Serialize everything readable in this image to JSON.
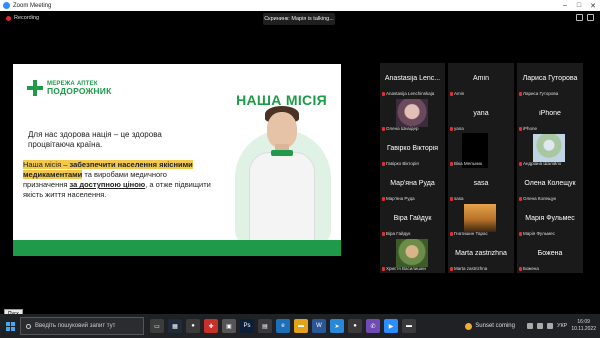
{
  "window": {
    "title": "Zoom Meeting",
    "recording_label": "Recording",
    "talking_indicator": "Скрининк: Марiя is talking..."
  },
  "slide": {
    "logo_line1": "МЕРЕЖА АПТЕК",
    "logo_line2": "ПОДОРОЖНИК",
    "heading": "НАША МІСІЯ",
    "para1": "Для нас здорова нація – це здорова процвітаюча країна.",
    "para2_a": "Наша місія – ",
    "para2_b": "забезпечити населення якісними медикаментами",
    "para2_c": " та виробами медичного призначення ",
    "para2_d": "за доступною ціною",
    "para2_e": ", а отже підвищити якість життя населення.",
    "brand_color": "#1f9a4a",
    "highlight_color": "#f2c94c"
  },
  "participants": [
    {
      "display": "Anastasija Lenc...",
      "sub": "Anastasija Lenchinskaja",
      "video": false
    },
    {
      "display": "Amin",
      "sub": "Amin",
      "video": false
    },
    {
      "display": "Лариса Гуторова",
      "sub": "Лариса Гуторова",
      "video": false
    },
    {
      "display": "",
      "sub": "Олена Шнаiдер",
      "video": true,
      "style": "v1"
    },
    {
      "display": "yana",
      "sub": "yana",
      "video": false
    },
    {
      "display": "iPhone",
      "sub": "iPhone",
      "video": false
    },
    {
      "display": "Гавірко Вікторія",
      "sub": "Гавірко Вікторія",
      "video": false
    },
    {
      "display": "",
      "sub": "Віка Мельник",
      "video": true,
      "style": "blk"
    },
    {
      "display": "",
      "sub": "Андріана Шалiйло",
      "video": true,
      "style": "v2"
    },
    {
      "display": "Мар'яна Руда",
      "sub": "Мар'яна Руда",
      "video": false
    },
    {
      "display": "sasa",
      "sub": "sasa",
      "video": false
    },
    {
      "display": "Олена Колещук",
      "sub": "Олена Колещук",
      "video": false
    },
    {
      "display": "Віра Гайдук",
      "sub": "Віра Гайдук",
      "video": false
    },
    {
      "display": "",
      "sub": "Гнатишин Тарас",
      "video": true,
      "style": "v3"
    },
    {
      "display": "Марія Фульмес",
      "sub": "Марія Фульмес",
      "video": false
    },
    {
      "display": "",
      "sub": "Христя Василишин",
      "video": true,
      "style": "v4"
    },
    {
      "display": "Marta zastrizhna",
      "sub": "Marta zastrizhna",
      "video": false
    },
    {
      "display": "Божена",
      "sub": "Божена",
      "video": false
    }
  ],
  "tooltip": "Пуск",
  "taskbar": {
    "search_placeholder": "Введіть пошуковий запит тут",
    "weather": "Sunset coming",
    "lang": "УКР",
    "time": "16:09",
    "date": "10.11.2022"
  }
}
